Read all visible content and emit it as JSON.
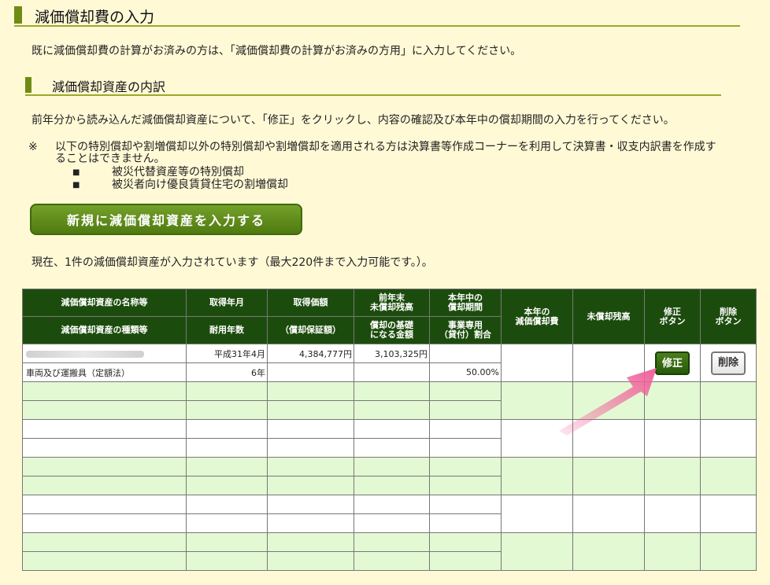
{
  "section_title": "減価償却費の入力",
  "intro_text": "既に減価償却費の計算がお済みの方は、「減価償却費の計算がお済みの方用」に入力してください。",
  "subsection_title": "減価償却資産の内訳",
  "instruction_text": "前年分から読み込んだ減価償却資産について、「修正」をクリックし、内容の確認及び本年中の償却期間の入力を行ってください。",
  "note": {
    "mark": "※",
    "text": "以下の特別償却や割増償却以外の特別償却や割増償却を適用される方は決算書等作成コーナーを利用して決算書・収支内訳書を作成することはできません。",
    "bullet": "■",
    "items": [
      "被災代替資産等の特別償却",
      "被災者向け優良賃貸住宅の割増償却"
    ]
  },
  "new_asset_button": "新規に減価償却資産を入力する",
  "count_text": "現在、1件の減価償却資産が入力されています（最大220件まで入力可能です。）。",
  "table": {
    "headers": {
      "name": "減価償却資産の名称等",
      "type": "減価償却資産の種類等",
      "acq_date": "取得年月",
      "useful_life": "耐用年数",
      "acq_price": "取得価額",
      "guarantee": "（償却保証額）",
      "prev_balance": "前年末\n未償却残高",
      "basis": "償却の基礎\nになる金額",
      "period": "本年中の\n償却期間",
      "business_ratio": "事業専用\n（貸付）割合",
      "current_dep": "本年の\n減価償却費",
      "unamortized": "未償却残高",
      "edit_col": "修正\nボタン",
      "delete_col": "削除\nボタン"
    },
    "row1": {
      "acq_date": "平成31年4月",
      "acq_price": "4,384,777円",
      "prev_balance": "3,103,325円",
      "type": "車両及び運搬具（定額法）",
      "useful_life": "6年",
      "business_ratio": "50.00%"
    },
    "edit_label": "修正",
    "delete_label": "削除",
    "empty_rows": 5
  },
  "colors": {
    "header_bg": "#1c4c0d",
    "row_alt": "#e3f9d3",
    "page_bg": "#fff9d6",
    "accent": "#6f8b12",
    "arrow": "#f0609a"
  }
}
